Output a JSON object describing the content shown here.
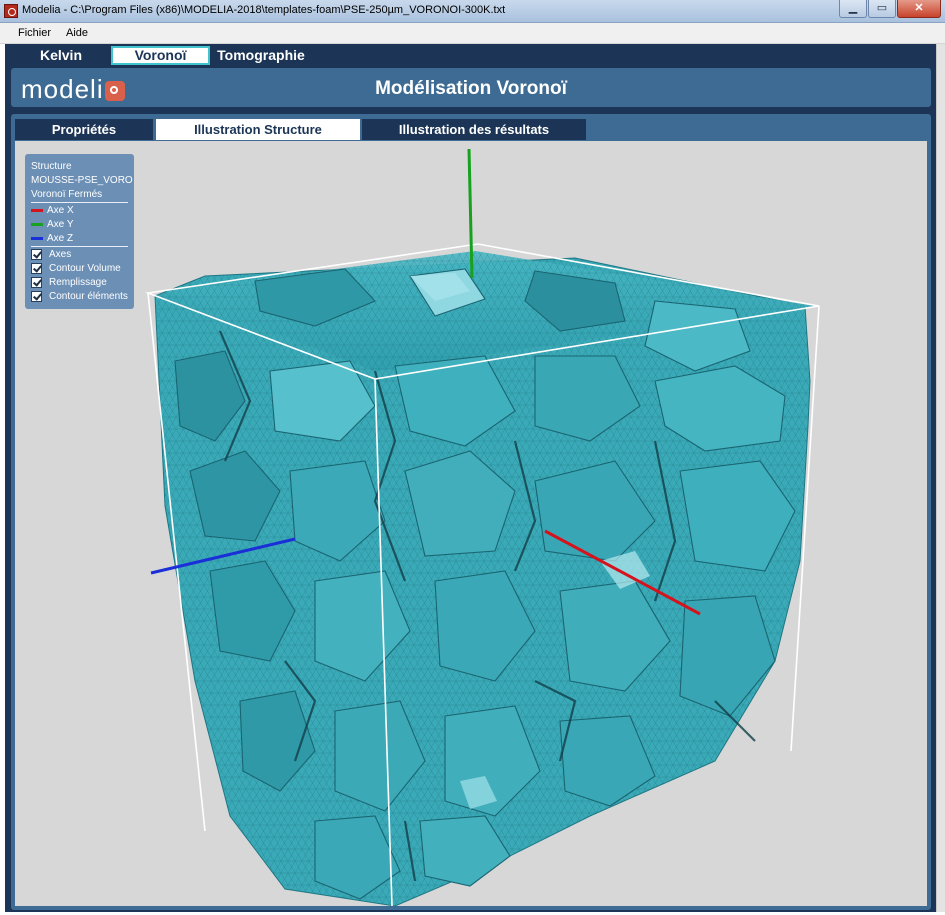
{
  "window": {
    "title": "Modelia - C:\\Program Files (x86)\\MODELIA-2018\\templates-foam\\PSE-250µm_VORONOI-300K.txt",
    "minimize": "▁",
    "maximize": "▭",
    "close": "✕"
  },
  "menu": {
    "file": "Fichier",
    "help": "Aide"
  },
  "model_tabs": [
    {
      "label": "Kelvin",
      "active": false
    },
    {
      "label": "Voronoï",
      "active": true
    },
    {
      "label": "Tomographie",
      "active": false
    }
  ],
  "header": {
    "logo": "modeli",
    "title": "Modélisation Voronoï"
  },
  "sub_tabs": [
    {
      "label": "Propriétés",
      "active": false
    },
    {
      "label": "Illustration Structure",
      "active": true
    },
    {
      "label": "Illustration des résultats",
      "active": false
    }
  ],
  "legend": {
    "structure_label": "Structure",
    "structure_name": "MOUSSE-PSE_VORO",
    "structure_type": "Voronoï Fermés",
    "axes": [
      {
        "label": "Axe X",
        "color": "#d4131d"
      },
      {
        "label": "Axe Y",
        "color": "#17a11f"
      },
      {
        "label": "Axe Z",
        "color": "#1b2fd8"
      }
    ],
    "options": [
      {
        "label": "Axes",
        "checked": true
      },
      {
        "label": "Contour Volume",
        "checked": true
      },
      {
        "label": "Remplissage",
        "checked": true
      },
      {
        "label": "Contour éléments",
        "checked": true
      }
    ]
  },
  "colors": {
    "app_background": "#1c3556",
    "panel": "#3e6b93",
    "viewport": "#d7d7d7",
    "foam": "#3aaab8",
    "edge_highlight": "#42c4cf"
  }
}
